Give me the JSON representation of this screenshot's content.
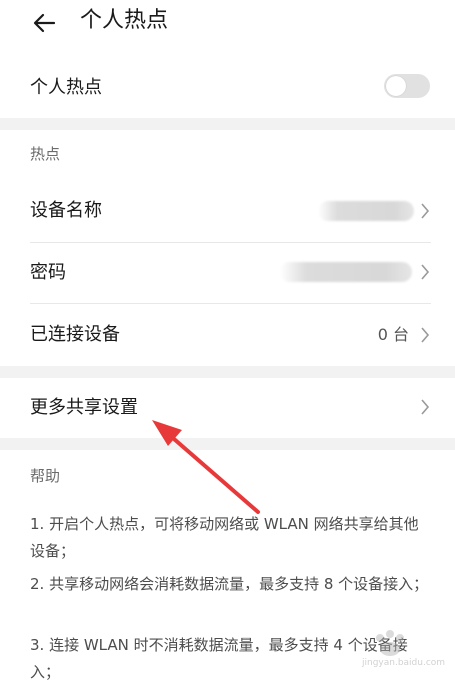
{
  "header": {
    "back_icon": "arrow-left-icon",
    "title": "个人热点"
  },
  "hotspot_toggle": {
    "label": "个人热点",
    "enabled": false
  },
  "hotspot_section": {
    "title": "热点",
    "device_name_label": "设备名称",
    "password_label": "密码",
    "connected_label": "已连接设备",
    "connected_value": "0 台"
  },
  "more_sharing": {
    "label": "更多共享设置"
  },
  "help": {
    "title": "帮助",
    "items": [
      "1. 开启个人热点，可将移动网络或 WLAN 网络共享给其他设备；",
      "2. 共享移动网络会消耗数据流量，最多支持 8 个设备接入；",
      "3. 连接 WLAN 时不消耗数据流量，最多支持 4 个设备接入；"
    ]
  },
  "colors": {
    "annotation_arrow": "#e8393a",
    "section_gap": "#f2f2f2",
    "toggle_off": "#e1e1e1"
  },
  "watermark": {
    "text": "jingyan.baidu.com"
  }
}
